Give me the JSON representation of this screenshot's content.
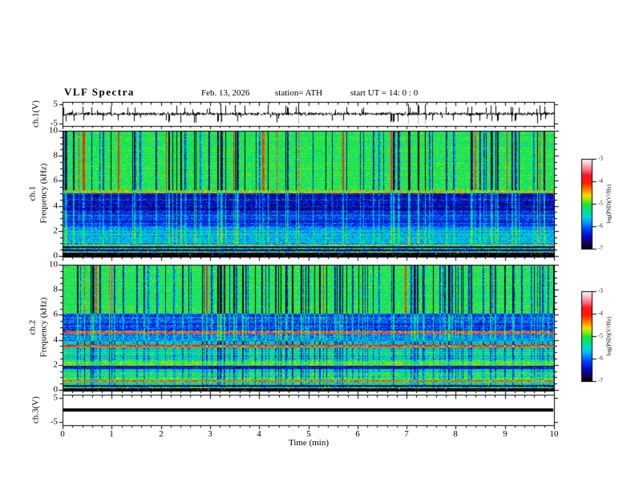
{
  "header": {
    "title": "VLF  Spectra",
    "date": "Feb. 13, 2026",
    "station": "station= ATH",
    "start_ut": "start UT =  14: 0 : 0"
  },
  "chart_data": {
    "x_axis": {
      "label": "Time  (min)",
      "min": 0,
      "max": 10,
      "major_ticks": [
        0,
        1,
        2,
        3,
        4,
        5,
        6,
        7,
        8,
        9,
        10
      ],
      "minor_per_major": 5
    },
    "colormap": {
      "domain": [
        -7,
        -3
      ],
      "stops": [
        [
          0.0,
          0,
          0,
          0
        ],
        [
          0.06,
          25,
          0,
          80
        ],
        [
          0.14,
          0,
          10,
          200
        ],
        [
          0.22,
          0,
          60,
          255
        ],
        [
          0.3,
          0,
          160,
          255
        ],
        [
          0.36,
          0,
          215,
          215
        ],
        [
          0.43,
          0,
          225,
          140
        ],
        [
          0.5,
          30,
          230,
          50
        ],
        [
          0.56,
          170,
          235,
          0
        ],
        [
          0.6,
          255,
          215,
          0
        ],
        [
          0.66,
          255,
          130,
          0
        ],
        [
          0.73,
          255,
          30,
          0
        ],
        [
          0.82,
          255,
          20,
          30
        ],
        [
          0.88,
          255,
          110,
          130
        ],
        [
          0.95,
          255,
          195,
          205
        ],
        [
          1.0,
          255,
          252,
          253
        ]
      ]
    },
    "colorbars": [
      {
        "title": "log(PSD)(V²/Hz)",
        "tick_labels": [
          "-3",
          "-4",
          "-5",
          "-6",
          "-7"
        ],
        "tick_values": [
          -3,
          -4,
          -5,
          -6,
          -7
        ],
        "range": [
          -7,
          -3
        ]
      },
      {
        "title": "log(PSD)(V²/Hz)",
        "tick_labels": [
          "-3",
          "-4",
          "-5",
          "-6",
          "-7"
        ],
        "tick_values": [
          -3,
          -4,
          -5,
          -6,
          -7
        ],
        "range": [
          -7,
          -3
        ]
      }
    ],
    "panels": [
      {
        "id": "ch1_waveform",
        "type": "line",
        "ylabel": "ch.1(V)",
        "ytick_labels": [
          "5",
          "-5"
        ],
        "ytick_values": [
          5,
          -5
        ],
        "ylim": [
          -6.25,
          6.25
        ],
        "gen": {
          "seed": 91121,
          "noise_sd": 0.5,
          "spike_prob": 0.04,
          "spike_min": 1.6,
          "spike_max": 5.1
        }
      },
      {
        "id": "ch1_spectrogram",
        "type": "heatmap",
        "channel": "ch.1",
        "ylabel": "Frequency  (kHz)",
        "ytick_values": [
          0,
          2,
          4,
          6,
          8,
          10
        ],
        "minor_step": 0.5,
        "ylim": [
          0,
          10
        ],
        "zlim": [
          -7,
          -3
        ],
        "streaks": {
          "seed": 40177,
          "density": 0.18,
          "hot_prob": 0.12
        },
        "noise_seed": 5501,
        "bands": [
          {
            "f": [
              0,
              0.3
            ],
            "base": -6.95,
            "noise": 0.12,
            "rowvar": 0.05,
            "streak": "none",
            "speck": 0.02
          },
          {
            "f": [
              0.3,
              0.42
            ],
            "base": -5.4,
            "noise": 0.85,
            "rowvar": 0.3,
            "streak": "none"
          },
          {
            "f": [
              0.42,
              0.55
            ],
            "base": -6.85,
            "noise": 0.25,
            "rowvar": 0.1,
            "streak": "none",
            "speck": 0.02
          },
          {
            "f": [
              0.55,
              0.68
            ],
            "base": -5.6,
            "noise": 0.75,
            "rowvar": 0.3,
            "streak": "none"
          },
          {
            "f": [
              0.68,
              0.8
            ],
            "base": -6.8,
            "noise": 0.3,
            "rowvar": 0.15,
            "streak": "none"
          },
          {
            "f": [
              0.8,
              0.98
            ],
            "base": -4.85,
            "noise": 0.4,
            "rowvar": 0.2,
            "streak": "cross"
          },
          {
            "f": [
              0.98,
              2.4
            ],
            "base": -5.75,
            "noise": 0.35,
            "rowvar": 0.22,
            "streak": "brighten"
          },
          {
            "f": [
              2.4,
              3.6
            ],
            "base": -6.15,
            "noise": 0.35,
            "rowvar": 0.33,
            "streak": "brighten"
          },
          {
            "f": [
              3.6,
              5.05
            ],
            "base": -6.5,
            "noise": 0.4,
            "rowvar": 0.25,
            "streak": "brighten"
          },
          {
            "f": [
              5.05,
              5.3
            ],
            "base": -4.75,
            "noise": 0.5,
            "rowvar": 0.25,
            "streak": "cross"
          },
          {
            "f": [
              5.3,
              10
            ],
            "base": -5.1,
            "noise": 0.28,
            "rowvar": 0.12,
            "streak": "darken"
          }
        ]
      },
      {
        "id": "ch2_spectrogram",
        "type": "heatmap",
        "channel": "ch.2",
        "ylabel": "Frequency  (kHz)",
        "ytick_values": [
          0,
          2,
          4,
          6,
          8,
          10
        ],
        "minor_step": 0.5,
        "ylim": [
          0,
          10
        ],
        "zlim": [
          -7,
          -3
        ],
        "streaks": {
          "seed": 88341,
          "density": 0.22,
          "hot_prob": 0.05
        },
        "noise_seed": 7707,
        "bands": [
          {
            "f": [
              0,
              0.18
            ],
            "base": -6.95,
            "noise": 0.1,
            "rowvar": 0.05,
            "streak": "none",
            "speck": 0.02
          },
          {
            "f": [
              0.18,
              0.3
            ],
            "base": -5.3,
            "noise": 0.85,
            "rowvar": 0.3,
            "streak": "none"
          },
          {
            "f": [
              0.3,
              0.45
            ],
            "base": -6.8,
            "noise": 0.35,
            "rowvar": 0.15,
            "streak": "none",
            "speck": 0.02
          },
          {
            "f": [
              0.45,
              0.68
            ],
            "base": -5.15,
            "noise": 0.45,
            "rowvar": 0.3,
            "streak": "cross"
          },
          {
            "f": [
              0.68,
              0.85
            ],
            "base": -4.15,
            "noise": 0.4,
            "rowvar": 0.25,
            "streak": "cross"
          },
          {
            "f": [
              0.85,
              1.75
            ],
            "base": -5.3,
            "noise": 0.45,
            "rowvar": 0.3,
            "streak": "dlight"
          },
          {
            "f": [
              1.75,
              1.95
            ],
            "base": -6.5,
            "noise": 0.4,
            "rowvar": 0.3,
            "streak": "none"
          },
          {
            "f": [
              1.95,
              2.35
            ],
            "base": -4.95,
            "noise": 0.35,
            "rowvar": 0.3,
            "streak": "cross"
          },
          {
            "f": [
              2.35,
              3.45
            ],
            "base": -5.35,
            "noise": 0.4,
            "rowvar": 0.3,
            "streak": "dlight"
          },
          {
            "f": [
              3.45,
              3.62
            ],
            "base": -4.0,
            "noise": 0.35,
            "rowvar": 0.2,
            "streak": "cross"
          },
          {
            "f": [
              3.62,
              3.95
            ],
            "base": -5.5,
            "noise": 0.45,
            "rowvar": 0.3,
            "streak": "dlight"
          },
          {
            "f": [
              3.95,
              4.5
            ],
            "base": -5.9,
            "noise": 0.4,
            "rowvar": 0.3,
            "streak": "brighten"
          },
          {
            "f": [
              4.5,
              4.72
            ],
            "base": -4.1,
            "noise": 0.55,
            "rowvar": 0.3,
            "streak": "cross"
          },
          {
            "f": [
              4.72,
              6.1
            ],
            "base": -6.1,
            "noise": 0.45,
            "rowvar": 0.3,
            "streak": "brighten"
          },
          {
            "f": [
              6.1,
              10
            ],
            "base": -5.1,
            "noise": 0.3,
            "rowvar": 0.12,
            "streak": "darken"
          }
        ]
      },
      {
        "id": "ch3_waveform",
        "type": "line",
        "ylabel": "ch.3(V)",
        "ytick_labels": [
          "5",
          "-5"
        ],
        "ytick_values": [
          5,
          -5
        ],
        "ylim": [
          -6.25,
          6.25
        ],
        "flat_value": 0
      }
    ]
  }
}
